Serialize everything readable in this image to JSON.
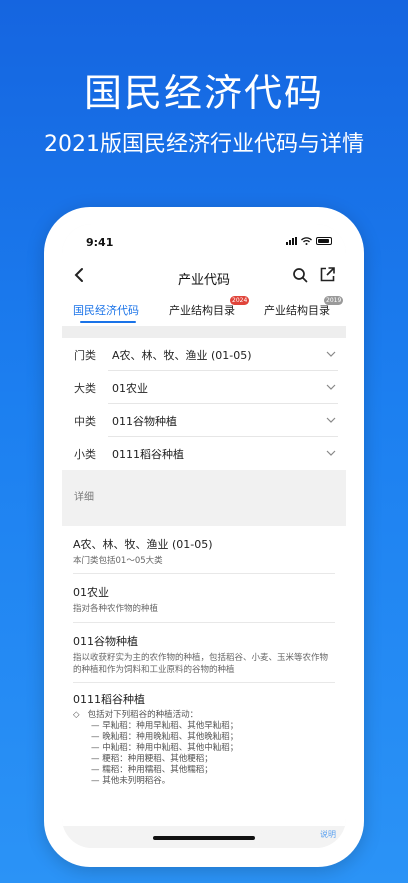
{
  "hero": {
    "title": "国民经济代码",
    "subtitle": "2021版国民经济行业代码与详情"
  },
  "status_bar": {
    "time": "9:41"
  },
  "nav": {
    "title": "产业代码",
    "back_icon": "chevron-left-icon",
    "search_icon": "search-icon",
    "share_icon": "share-icon"
  },
  "tabs": [
    {
      "label": "国民经济代码",
      "active": true
    },
    {
      "label": "产业结构目录",
      "badge": "2024"
    },
    {
      "label": "产业结构目录",
      "badge": "2019"
    }
  ],
  "filters": [
    {
      "label": "门类",
      "value": "A农、林、牧、渔业 (01-05)"
    },
    {
      "label": "大类",
      "value": "01农业"
    },
    {
      "label": "中类",
      "value": "011谷物种植"
    },
    {
      "label": "小类",
      "value": "0111稻谷种植"
    }
  ],
  "detail_header": "详细",
  "details": {
    "section1": {
      "title": "A农、林、牧、渔业 (01-05)",
      "desc": "本门类包括01～05大类"
    },
    "section2": {
      "title": "01农业",
      "desc": "指对各种农作物的种植"
    },
    "section3": {
      "title": "011谷物种植",
      "desc": "指以收获籽实为主的农作物的种植，包括稻谷、小麦、玉米等农作物的种植和作为饲料和工业原料的谷物的种植"
    },
    "section4": {
      "title": "0111稻谷种植",
      "lead": "包括对下列稻谷的种植活动：",
      "items": [
        "—    早籼稻：种用早籼稻、其他早籼稻；",
        "—    晚籼稻：种用晚籼稻、其他晚籼稻；",
        "—    中籼稻：种用中籼稻、其他中籼稻；",
        "—    粳稻：种用粳稻、其他粳稻；",
        "—    糯稻：种用糯稻、其他糯稻；",
        "—    其他未列明稻谷。"
      ]
    }
  },
  "footer_text": "说明",
  "colors": {
    "accent": "#1a73e8",
    "background_top": "#1565e0",
    "badge_red": "#e0443a"
  }
}
